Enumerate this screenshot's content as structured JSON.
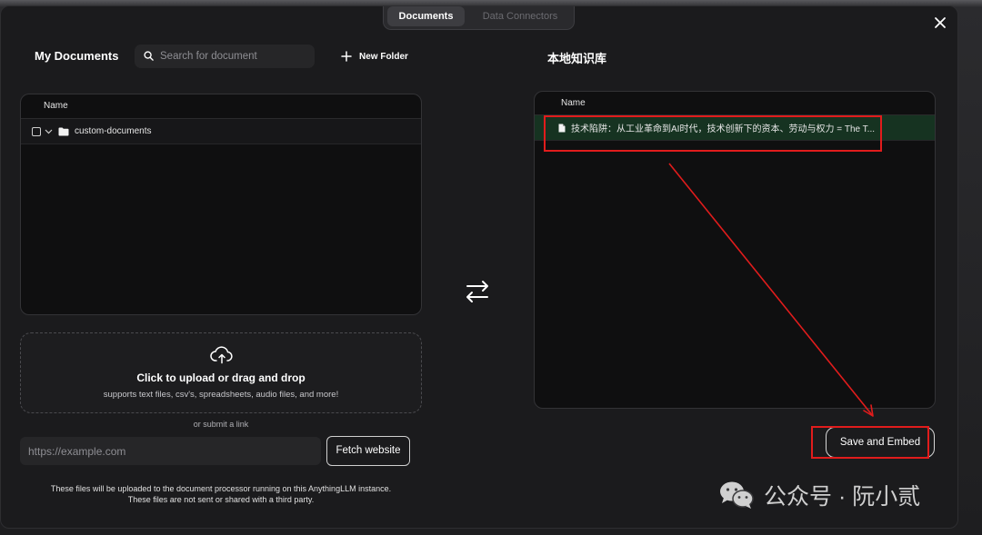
{
  "tabs": [
    {
      "label": "Documents",
      "active": true
    },
    {
      "label": "Data Connectors",
      "active": false
    }
  ],
  "left": {
    "title": "My Documents",
    "search_placeholder": "Search for document",
    "new_folder_label": "New Folder",
    "column_name": "Name",
    "folders": [
      {
        "label": "custom-documents"
      }
    ],
    "upload": {
      "title": "Click to upload or drag and drop",
      "subtitle": "supports text files, csv's, spreadsheets, audio files, and more!"
    },
    "or_submit": "or submit a link",
    "url_placeholder": "https://example.com",
    "fetch_label": "Fetch website",
    "notice_line1": "These files will be uploaded to the document processor running on this AnythingLLM instance.",
    "notice_line2": "These files are not sent or shared with a third party."
  },
  "right": {
    "title": "本地知识库",
    "column_name": "Name",
    "files": [
      {
        "label": "技术陷阱：从工业革命到AI时代，技术创新下的资本、劳动与权力 = The T..."
      }
    ],
    "save_label": "Save and Embed"
  },
  "watermark": {
    "text": "公众号 · 阮小贰"
  },
  "colors": {
    "annotation": "#e11c1c",
    "selected_row": "#163321",
    "modal_bg": "#1b1b1d"
  }
}
